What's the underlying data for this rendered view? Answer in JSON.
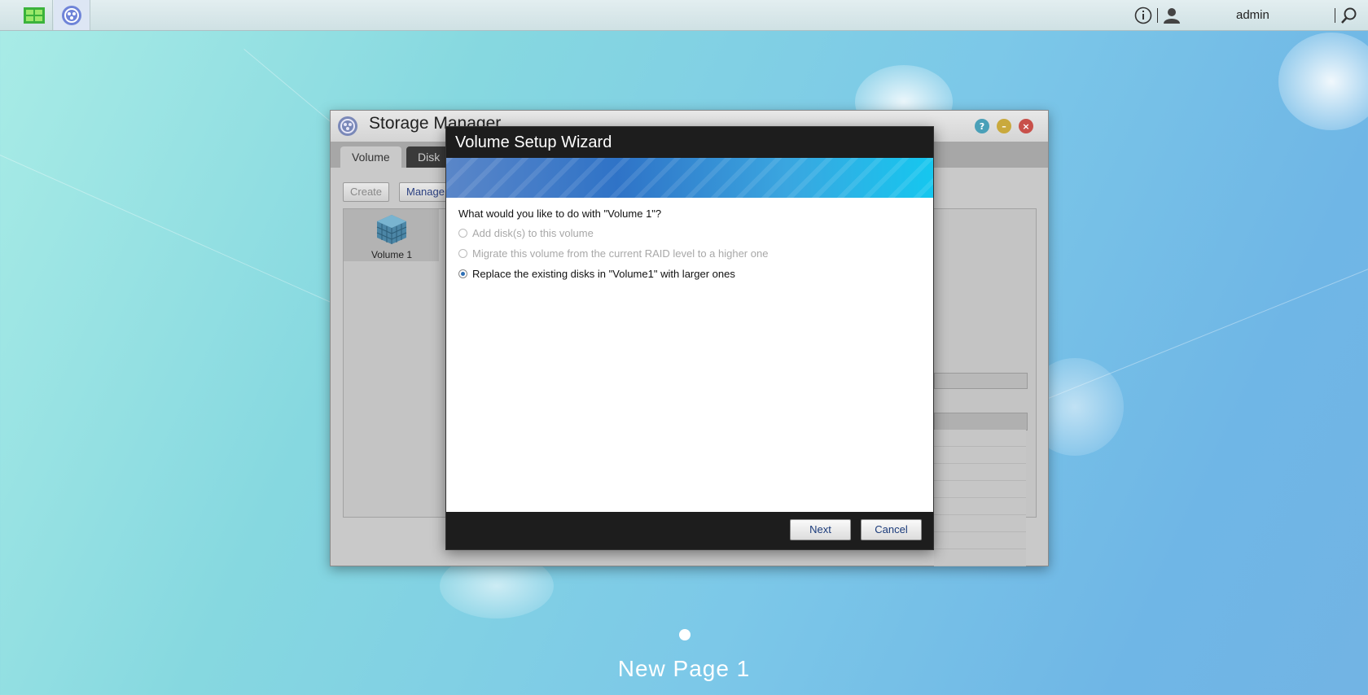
{
  "topbar": {
    "user": "admin",
    "icons": [
      "app-launcher-icon",
      "storage-manager-icon",
      "info-icon",
      "user-icon",
      "search-icon"
    ]
  },
  "storage_manager": {
    "title": "Storage Manager",
    "tabs": [
      {
        "label": "Volume"
      },
      {
        "label": "Disk"
      }
    ],
    "toolbar": {
      "create_label": "Create",
      "manage_label": "Manage"
    },
    "volumes": [
      {
        "label": "Volume 1"
      }
    ]
  },
  "wizard": {
    "title": "Volume Setup Wizard",
    "question": "What would you like to do with \"Volume 1\"?",
    "options": [
      {
        "label": "Add disk(s) to this volume",
        "enabled": false,
        "selected": false
      },
      {
        "label": "Migrate this volume from the current RAID level to a higher one",
        "enabled": false,
        "selected": false
      },
      {
        "label": "Replace the existing disks in \"Volume1\" with larger ones",
        "enabled": true,
        "selected": true
      }
    ],
    "next_label": "Next",
    "cancel_label": "Cancel"
  },
  "desktop": {
    "page_label": "New Page 1"
  },
  "colors": {
    "accent": "#2e6fb5",
    "banner_start": "#2f73c7",
    "banner_end": "#15c7ef",
    "wizard_chrome": "#1d1d1d"
  }
}
